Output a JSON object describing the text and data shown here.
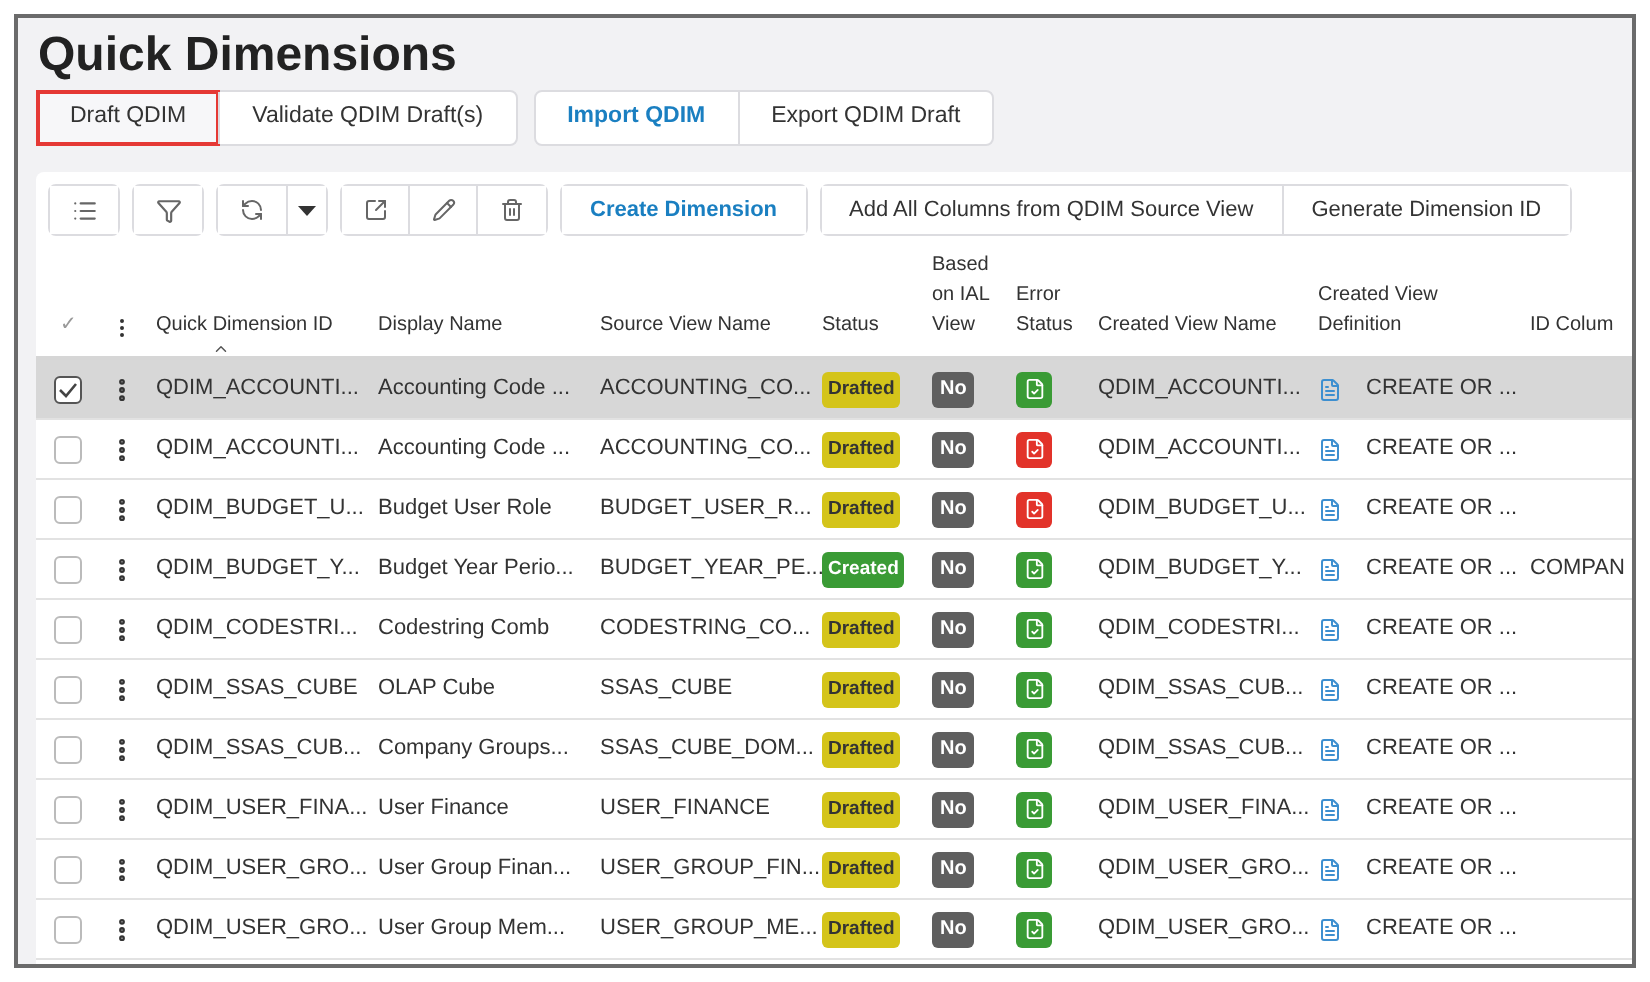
{
  "title": "Quick Dimensions",
  "actions": [
    {
      "label": "Draft QDIM",
      "highlighted": true,
      "primary": false
    },
    {
      "label": "Validate QDIM Draft(s)",
      "highlighted": false,
      "primary": false
    },
    {
      "label": "Import QDIM",
      "highlighted": false,
      "primary": true
    },
    {
      "label": "Export QDIM Draft",
      "highlighted": false,
      "primary": false
    }
  ],
  "toolbar": {
    "commands": [
      {
        "label": "Create Dimension",
        "primary": true
      },
      {
        "label": "Add All Columns from QDIM Source View",
        "primary": false
      },
      {
        "label": "Generate Dimension ID",
        "primary": false
      }
    ]
  },
  "table": {
    "select_mark": "✓",
    "columns": [
      "Quick Dimension ID",
      "Display Name",
      "Source View Name",
      "Status",
      "Based on IAL View",
      "Error Status",
      "Created View Name",
      "Created View Definition",
      "ID Colum"
    ],
    "rows": [
      {
        "selected": true,
        "id": "QDIM_ACCOUNTI...",
        "display": "Accounting Code ...",
        "source": "ACCOUNTING_CO...",
        "status": "Drafted",
        "created": false,
        "ial": "No",
        "has_error": false,
        "view": "QDIM_ACCOUNTI...",
        "definition": "CREATE OR ..."
      },
      {
        "selected": false,
        "id": "QDIM_ACCOUNTI...",
        "display": "Accounting Code ...",
        "source": "ACCOUNTING_CO...",
        "status": "Drafted",
        "created": false,
        "ial": "No",
        "has_error": true,
        "view": "QDIM_ACCOUNTI...",
        "definition": "CREATE OR ..."
      },
      {
        "selected": false,
        "id": "QDIM_BUDGET_U...",
        "display": "Budget User Role",
        "source": "BUDGET_USER_R...",
        "status": "Drafted",
        "created": false,
        "ial": "No",
        "has_error": true,
        "view": "QDIM_BUDGET_U...",
        "definition": "CREATE OR ..."
      },
      {
        "selected": false,
        "id": "QDIM_BUDGET_Y...",
        "display": "Budget Year Perio...",
        "source": "BUDGET_YEAR_PE...",
        "status": "Created",
        "created": true,
        "ial": "No",
        "has_error": false,
        "view": "QDIM_BUDGET_Y...",
        "definition": "CREATE OR ...",
        "id_column": "COMPAN"
      },
      {
        "selected": false,
        "id": "QDIM_CODESTRI...",
        "display": "Codestring Comb",
        "source": "CODESTRING_CO...",
        "status": "Drafted",
        "created": false,
        "ial": "No",
        "has_error": false,
        "view": "QDIM_CODESTRI...",
        "definition": "CREATE OR ..."
      },
      {
        "selected": false,
        "id": "QDIM_SSAS_CUBE",
        "display": "OLAP Cube",
        "source": "SSAS_CUBE",
        "status": "Drafted",
        "created": false,
        "ial": "No",
        "has_error": false,
        "view": "QDIM_SSAS_CUB...",
        "definition": "CREATE OR ..."
      },
      {
        "selected": false,
        "id": "QDIM_SSAS_CUB...",
        "display": "Company Groups...",
        "source": "SSAS_CUBE_DOM...",
        "status": "Drafted",
        "created": false,
        "ial": "No",
        "has_error": false,
        "view": "QDIM_SSAS_CUB...",
        "definition": "CREATE OR ..."
      },
      {
        "selected": false,
        "id": "QDIM_USER_FINA...",
        "display": "User Finance",
        "source": "USER_FINANCE",
        "status": "Drafted",
        "created": false,
        "ial": "No",
        "has_error": false,
        "view": "QDIM_USER_FINA...",
        "definition": "CREATE OR ..."
      },
      {
        "selected": false,
        "id": "QDIM_USER_GRO...",
        "display": "User Group Finan...",
        "source": "USER_GROUP_FIN...",
        "status": "Drafted",
        "created": false,
        "ial": "No",
        "has_error": false,
        "view": "QDIM_USER_GRO...",
        "definition": "CREATE OR ..."
      },
      {
        "selected": false,
        "id": "QDIM_USER_GRO...",
        "display": "User Group Mem...",
        "source": "USER_GROUP_ME...",
        "status": "Drafted",
        "created": false,
        "ial": "No",
        "has_error": false,
        "view": "QDIM_USER_GRO...",
        "definition": "CREATE OR ..."
      }
    ]
  }
}
